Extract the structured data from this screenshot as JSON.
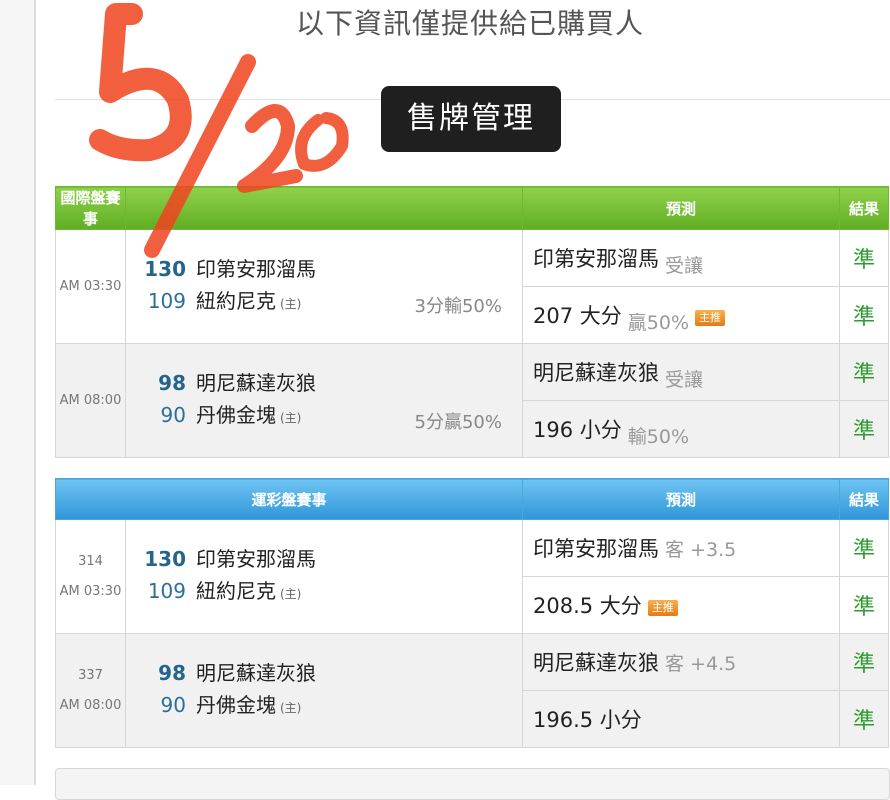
{
  "notice": "以下資訊僅提供給已購買人",
  "tooltip": "售牌管理",
  "stamp_text": "5/20",
  "intl": {
    "headers": [
      "國際盤賽事",
      "預測",
      "結果"
    ],
    "games": [
      {
        "time": "AM 03:30",
        "away": {
          "num": "130",
          "name": "印第安那溜馬"
        },
        "home": {
          "num": "109",
          "name": "紐約尼克",
          "tag": "(主)"
        },
        "spread": "3分輸50%",
        "picks": [
          {
            "main": "印第安那溜馬",
            "sub": "受讓",
            "result": "準"
          },
          {
            "main": "207 大分",
            "sub": "贏50%",
            "badge": "主推",
            "result": "準"
          }
        ]
      },
      {
        "time": "AM 08:00",
        "away": {
          "num": "98",
          "name": "明尼蘇達灰狼"
        },
        "home": {
          "num": "90",
          "name": "丹佛金塊",
          "tag": "(主)"
        },
        "spread": "5分贏50%",
        "picks": [
          {
            "main": "明尼蘇達灰狼",
            "sub": "受讓",
            "result": "準"
          },
          {
            "main": "196 小分",
            "sub": "輸50%",
            "result": "準"
          }
        ]
      }
    ]
  },
  "lottery": {
    "headers": [
      "運彩盤賽事",
      "預測",
      "結果"
    ],
    "games": [
      {
        "code": "314",
        "time": "AM 03:30",
        "away": {
          "num": "130",
          "name": "印第安那溜馬"
        },
        "home": {
          "num": "109",
          "name": "紐約尼克",
          "tag": "(主)"
        },
        "picks": [
          {
            "main": "印第安那溜馬",
            "sub": "客 +3.5",
            "result": "準"
          },
          {
            "main": "208.5 大分",
            "badge": "主推",
            "result": "準"
          }
        ]
      },
      {
        "code": "337",
        "time": "AM 08:00",
        "away": {
          "num": "98",
          "name": "明尼蘇達灰狼"
        },
        "home": {
          "num": "90",
          "name": "丹佛金塊",
          "tag": "(主)"
        },
        "picks": [
          {
            "main": "明尼蘇達灰狼",
            "sub": "客 +4.5",
            "result": "準"
          },
          {
            "main": "196.5 小分",
            "result": "準"
          }
        ]
      }
    ]
  },
  "colors": {
    "intl_header": "#6fb832",
    "lottery_header": "#3a9fdd",
    "result": "#2e9b2e",
    "stamp": "#f0441e"
  }
}
